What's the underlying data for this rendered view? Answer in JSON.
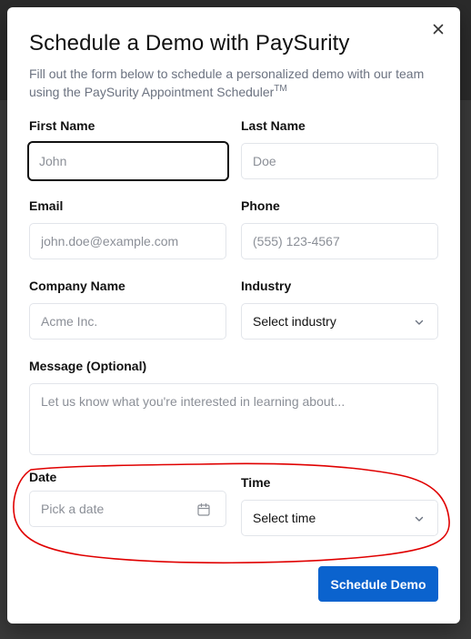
{
  "dialog": {
    "title": "Schedule a Demo with PaySurity",
    "subtitle": "Fill out the form below to schedule a personalized demo with our team using the PaySurity Appointment Scheduler",
    "subtitle_mark": "TM",
    "close_icon": "close-icon"
  },
  "form": {
    "first_name": {
      "label": "First Name",
      "placeholder": "John",
      "focused": true
    },
    "last_name": {
      "label": "Last Name",
      "placeholder": "Doe"
    },
    "email": {
      "label": "Email",
      "placeholder": "john.doe@example.com"
    },
    "phone": {
      "label": "Phone",
      "placeholder": "(555) 123-4567"
    },
    "company": {
      "label": "Company Name",
      "placeholder": "Acme Inc."
    },
    "industry": {
      "label": "Industry",
      "value": "Select industry",
      "icon": "chevron-down-icon"
    },
    "message": {
      "label": "Message (Optional)",
      "placeholder": "Let us know what you're interested in learning about..."
    },
    "date": {
      "label": "Date",
      "placeholder": "Pick a date",
      "icon": "calendar-icon"
    },
    "time": {
      "label": "Time",
      "value": "Select time",
      "icon": "chevron-down-icon"
    }
  },
  "actions": {
    "submit_label": "Schedule Demo"
  },
  "colors": {
    "primary": "#0b63ce",
    "annotation": "#e00000",
    "focus_border": "#111111",
    "placeholder": "#8b8f97"
  }
}
